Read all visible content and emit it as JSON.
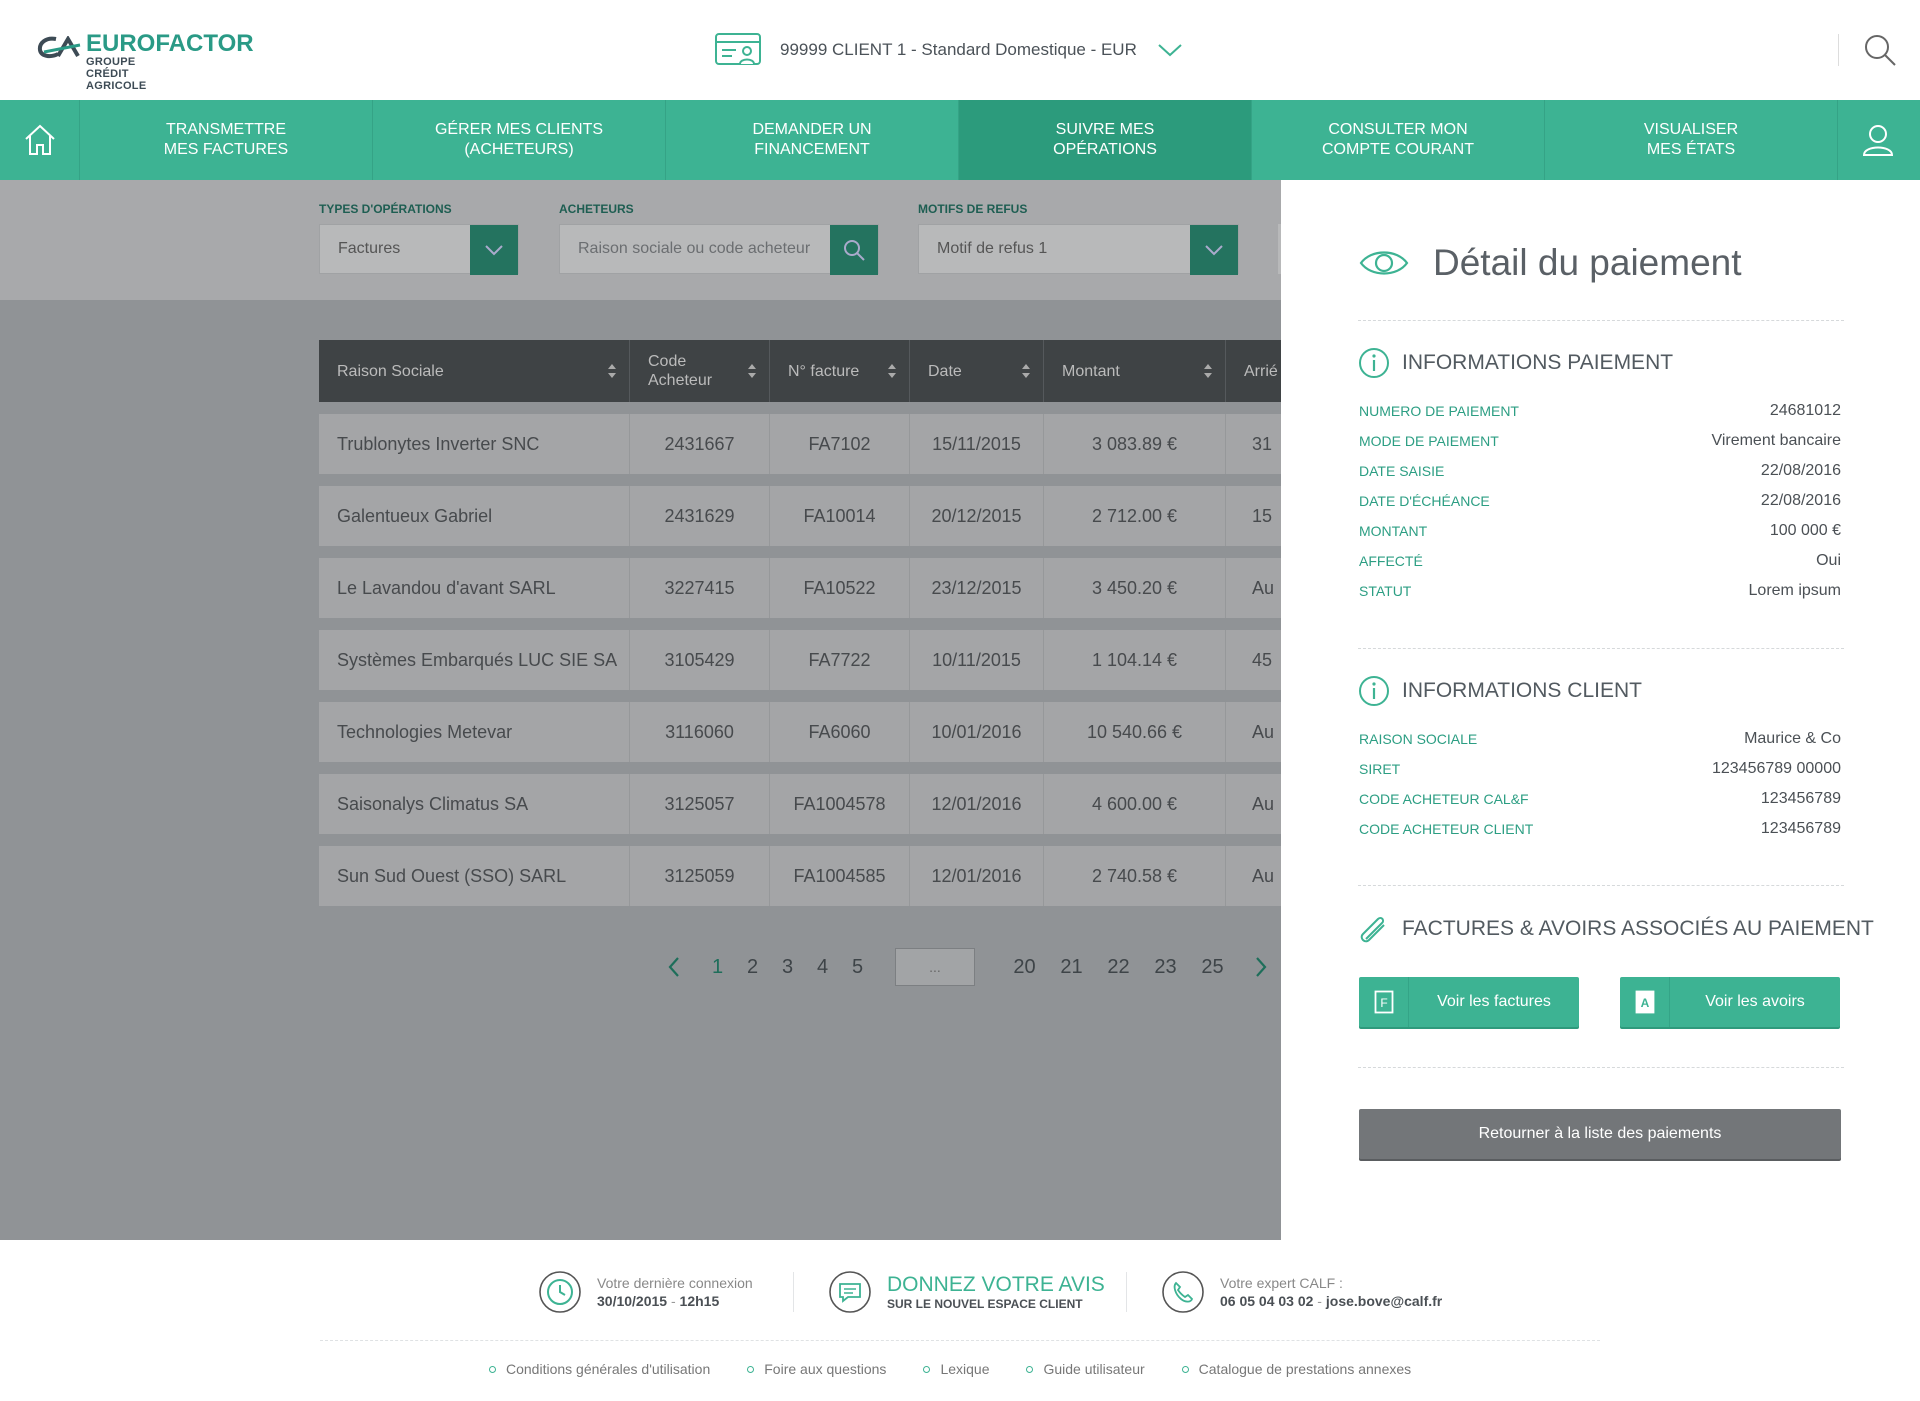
{
  "header": {
    "logo_name": "EUROFACTOR",
    "logo_sub": "GROUPE CRÉDIT AGRICOLE",
    "client_selector": "99999 CLIENT 1 -  Standard Domestique  - EUR"
  },
  "nav": {
    "items": [
      {
        "label": "TRANSMETTRE\nMES FACTURES"
      },
      {
        "label": "GÉRER MES CLIENTS\n(ACHETEURS)"
      },
      {
        "label": "DEMANDER UN\nFINANCEMENT"
      },
      {
        "label": "SUIVRE MES\nOPÉRATIONS"
      },
      {
        "label": "CONSULTER MON\nCOMPTE COURANT"
      },
      {
        "label": "VISUALISER\nMES ÉTATS"
      }
    ],
    "active_index": 3
  },
  "filters": {
    "types_label": "TYPES D'OPÉRATIONS",
    "types_value": "Factures",
    "acheteurs_label": "ACHETEURS",
    "acheteurs_placeholder": "Raison sociale ou code acheteur",
    "motifs_label": "MOTIFS DE REFUS",
    "motifs_value": "Motif de refus 1"
  },
  "table": {
    "columns": [
      "Raison Sociale",
      "Code\nAcheteur",
      "N° facture",
      "Date",
      "Montant",
      "Arrié"
    ],
    "rows": [
      [
        "Trublonytes Inverter SNC",
        "2431667",
        "FA7102",
        "15/11/2015",
        "3 083.89 €",
        "31"
      ],
      [
        "Galentueux Gabriel",
        "2431629",
        "FA10014",
        "20/12/2015",
        "2 712.00 €",
        "15"
      ],
      [
        "Le Lavandou d'avant SARL",
        "3227415",
        "FA10522",
        "23/12/2015",
        "3 450.20 €",
        "Au"
      ],
      [
        "Systèmes Embarqués LUC SIE SA",
        "3105429",
        "FA7722",
        "10/11/2015",
        "1 104.14 €",
        "45"
      ],
      [
        "Technologies Metevar",
        "3116060",
        "FA6060",
        "10/01/2016",
        "10 540.66 €",
        "Au"
      ],
      [
        "Saisonalys Climatus SA",
        "3125057",
        "FA1004578",
        "12/01/2016",
        "4 600.00 €",
        "Au"
      ],
      [
        "Sun Sud Ouest (SSO) SARL",
        "3125059",
        "FA1004585",
        "12/01/2016",
        "2 740.58 €",
        "Au"
      ]
    ]
  },
  "pagination": {
    "pages_start": [
      "1",
      "2",
      "3",
      "4",
      "5"
    ],
    "dots": "...",
    "pages_end": [
      "20",
      "21",
      "22",
      "23",
      "25"
    ],
    "current": "1"
  },
  "panel": {
    "title": "Détail du paiement",
    "payment_section_title": "INFORMATIONS PAIEMENT",
    "payment_info": [
      {
        "key": "NUMERO DE PAIEMENT",
        "value": "24681012"
      },
      {
        "key": "MODE DE PAIEMENT",
        "value": "Virement bancaire"
      },
      {
        "key": "DATE SAISIE",
        "value": "22/08/2016"
      },
      {
        "key": "DATE D'ÉCHÉANCE",
        "value": "22/08/2016"
      },
      {
        "key": "MONTANT",
        "value": "100 000 €"
      },
      {
        "key": "AFFECTÉ",
        "value": "Oui"
      },
      {
        "key": "STATUT",
        "value": "Lorem ipsum"
      }
    ],
    "client_section_title": "INFORMATIONS CLIENT",
    "client_info": [
      {
        "key": "RAISON SOCIALE",
        "value": "Maurice & Co"
      },
      {
        "key": "SIRET",
        "value": "123456789 00000"
      },
      {
        "key": "CODE ACHETEUR CAL&F",
        "value": "123456789"
      },
      {
        "key": "CODE ACHETEUR CLIENT",
        "value": "123456789"
      }
    ],
    "assoc_section_title": "FACTURES & AVOIRS ASSOCIÉS AU PAIEMENT",
    "btn_factures": "Voir les factures",
    "btn_factures_icon": "F",
    "btn_avoirs": "Voir les avoirs",
    "btn_avoirs_icon": "A",
    "btn_return": "Retourner à la liste des paiements"
  },
  "footer": {
    "last_login_label": "Votre dernière connexion",
    "last_login_date": "30/10/2015",
    "last_login_sep": " - ",
    "last_login_time": "12h15",
    "feedback_title": "DONNEZ VOTRE AVIS",
    "feedback_sub": "SUR LE NOUVEL ESPACE CLIENT",
    "expert_label": "Votre expert CALF :",
    "expert_phone": "06 05 04 03 02",
    "expert_sep": " - ",
    "expert_email": "jose.bove@calf.fr",
    "links": [
      "Conditions générales d'utilisation",
      "Foire aux questions",
      "Lexique",
      "Guide utilisateur",
      "Catalogue de prestations annexes"
    ]
  },
  "colors": {
    "brand_green": "#3db393",
    "nav_active": "#2c9b7c",
    "dark_header": "#3f4345"
  }
}
